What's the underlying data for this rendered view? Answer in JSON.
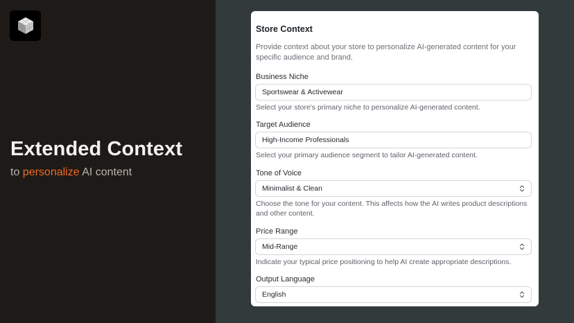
{
  "hero": {
    "title": "Extended Context",
    "subtitle_prefix": "to ",
    "subtitle_accent": "personalize",
    "subtitle_suffix": " AI content",
    "accent_color": "#f26a21",
    "logo_icon": "cube-icon"
  },
  "card": {
    "title": "Store Context",
    "description": "Provide context about your store to personalize AI-generated content for your specific audience and brand."
  },
  "fields": {
    "niche": {
      "label": "Business Niche",
      "value": "Sportswear & Activewear",
      "help": "Select your store's primary niche to personalize AI-generated content."
    },
    "audience": {
      "label": "Target Audience",
      "value": "High-Income Professionals",
      "help": "Select your primary audience segment to tailor AI-generated content."
    },
    "tone": {
      "label": "Tone of Voice",
      "value": "Minimalist & Clean",
      "help": "Choose the tone for your content. This affects how the AI writes product descriptions and other content."
    },
    "price": {
      "label": "Price Range",
      "value": "Mid-Range",
      "help": "Indicate your typical price positioning to help AI create appropriate descriptions."
    },
    "language": {
      "label": "Output Language",
      "value": "English"
    }
  }
}
